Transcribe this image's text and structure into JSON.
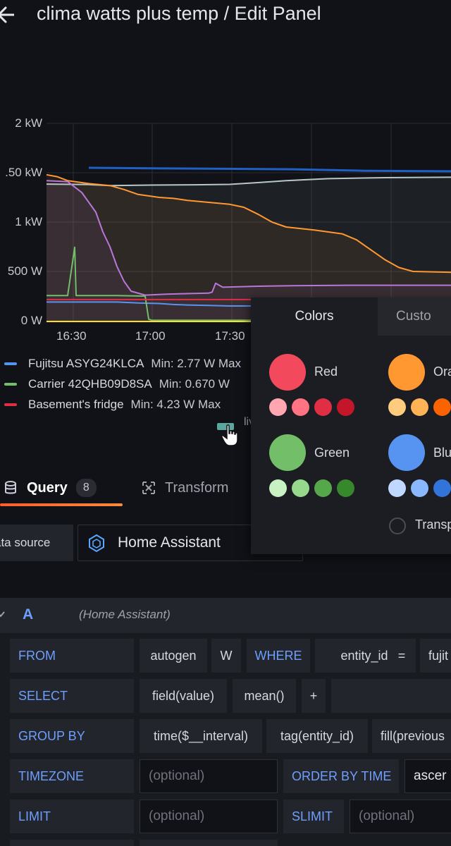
{
  "header": {
    "title": "clima watts plus temp / Edit Panel",
    "back_icon": "arrow-left-icon"
  },
  "chart_data": {
    "type": "line",
    "yticks": [
      "2 kW",
      ".50 kW",
      "1 kW",
      "500 W",
      "0 W"
    ],
    "xticks": [
      "16:30",
      "17:00",
      "17:30"
    ],
    "ylim": [
      0,
      2000
    ],
    "grid": true,
    "series": [
      {
        "name": "Fujitsu ASYG24KLCA",
        "color": "#5794F2",
        "values": [
          [
            0,
            190
          ],
          [
            60,
            190
          ],
          [
            100,
            190
          ],
          [
            130,
            180
          ],
          [
            160,
            175
          ],
          [
            180,
            165
          ],
          [
            200,
            160
          ],
          [
            230,
            155
          ],
          [
            260,
            150
          ],
          [
            300,
            150
          ],
          [
            330,
            148
          ],
          [
            360,
            150
          ],
          [
            420,
            150
          ],
          [
            500,
            150
          ],
          [
            580,
            150
          ]
        ]
      },
      {
        "name": "Carrier 42QHB09D8SA",
        "color": "#73BF69",
        "values": [
          [
            0,
            255
          ],
          [
            30,
            255
          ],
          [
            40,
            745
          ],
          [
            42,
            255
          ],
          [
            100,
            255
          ],
          [
            140,
            250
          ],
          [
            145,
            15
          ],
          [
            150,
            5
          ],
          [
            580,
            5
          ]
        ]
      },
      {
        "name": "Basement's fridge",
        "color": "#E02F44",
        "values": [
          [
            0,
            215
          ],
          [
            580,
            215
          ]
        ]
      },
      {
        "name": "",
        "color": "#1F60C4",
        "values": [
          [
            60,
            1550
          ],
          [
            150,
            1545
          ],
          [
            250,
            1540
          ],
          [
            350,
            1535
          ],
          [
            450,
            1520
          ],
          [
            580,
            1515
          ]
        ]
      },
      {
        "name": "",
        "color": "#B8C7C5",
        "values": [
          [
            0,
            1385
          ],
          [
            60,
            1380
          ],
          [
            90,
            1370
          ],
          [
            150,
            1375
          ],
          [
            210,
            1378
          ],
          [
            260,
            1382
          ],
          [
            300,
            1400
          ],
          [
            340,
            1420
          ],
          [
            400,
            1440
          ],
          [
            480,
            1450
          ],
          [
            580,
            1455
          ]
        ]
      },
      {
        "name": "",
        "color": "#FF9830",
        "values": [
          [
            0,
            1480
          ],
          [
            15,
            1460
          ],
          [
            30,
            1420
          ],
          [
            60,
            1390
          ],
          [
            90,
            1370
          ],
          [
            110,
            1330
          ],
          [
            130,
            1280
          ],
          [
            160,
            1250
          ],
          [
            180,
            1240
          ],
          [
            200,
            1220
          ],
          [
            230,
            1200
          ],
          [
            260,
            1180
          ],
          [
            280,
            1150
          ],
          [
            300,
            1080
          ],
          [
            320,
            1000
          ],
          [
            340,
            950
          ],
          [
            380,
            920
          ],
          [
            420,
            880
          ],
          [
            440,
            820
          ],
          [
            460,
            720
          ],
          [
            480,
            620
          ],
          [
            500,
            540
          ],
          [
            520,
            500
          ],
          [
            580,
            490
          ]
        ]
      },
      {
        "name": "",
        "color": "#B877D9",
        "values": [
          [
            0,
            1420
          ],
          [
            30,
            1410
          ],
          [
            50,
            1300
          ],
          [
            70,
            1100
          ],
          [
            80,
            900
          ],
          [
            90,
            750
          ],
          [
            100,
            550
          ],
          [
            110,
            400
          ],
          [
            120,
            300
          ],
          [
            140,
            260
          ],
          [
            170,
            270
          ],
          [
            230,
            280
          ],
          [
            235,
            290
          ],
          [
            240,
            380
          ],
          [
            250,
            340
          ],
          [
            300,
            350
          ],
          [
            350,
            355
          ],
          [
            430,
            360
          ],
          [
            500,
            360
          ],
          [
            580,
            360
          ]
        ]
      }
    ]
  },
  "legend": {
    "items": [
      {
        "name": "Fujitsu ASYG24KLCA",
        "stat": "Min: 2.77 W  Max",
        "color": "#5794F2"
      },
      {
        "name": "Carrier 42QHB09D8SA",
        "stat": "Min: 0.670 W",
        "color": "#73BF69"
      },
      {
        "name": "Basement's fridge",
        "stat": "Min: 4.23 W  Max",
        "color": "#E02F44"
      }
    ]
  },
  "cursor_text": "liv",
  "tabs": {
    "query_label": "Query",
    "query_count": "8",
    "transform_label": "Transform"
  },
  "datasource": {
    "label": "Data source",
    "label_visible": "ata source",
    "value": "Home Assistant"
  },
  "query": {
    "ref": "A",
    "ds": "(Home Assistant)",
    "from": {
      "label": "FROM",
      "policy": "autogen",
      "measurement": "W",
      "where": "WHERE",
      "key": "entity_id",
      "op": "=",
      "value": "fujit"
    },
    "select": {
      "label": "SELECT",
      "field": "field(value)",
      "agg": "mean()",
      "add": "+"
    },
    "group_by": {
      "label": "GROUP BY",
      "time": "time($__interval)",
      "tag": "tag(entity_id)",
      "fill": "fill(previous"
    },
    "timezone": {
      "label": "TIMEZONE",
      "placeholder": "(optional)",
      "order_label": "ORDER BY TIME",
      "order_value": "ascer"
    },
    "limit": {
      "label": "LIMIT",
      "placeholder": "(optional)",
      "slimit_label": "SLIMIT",
      "slimit_placeholder": "(optional)"
    }
  },
  "color_picker": {
    "tab_colors": "Colors",
    "tab_custom": "Custom",
    "tab_custom_visible": "Custo",
    "groups": [
      {
        "name": "Red",
        "main": "#F2495C",
        "shades": [
          "#FFA6B0",
          "#FF7383",
          "#E02F44",
          "#C4162A"
        ]
      },
      {
        "name": "Ora",
        "main": "#FF9830",
        "shades": [
          "#FFCB7D",
          "#FFB357",
          "#FA6400",
          "#FA6400"
        ]
      },
      {
        "name": "Green",
        "main": "#73BF69",
        "shades": [
          "#C8F2C2",
          "#96D98D",
          "#56A64B",
          "#37872D"
        ]
      },
      {
        "name": "Blu",
        "main": "#5794F2",
        "shades": [
          "#C0D8FF",
          "#8AB8FF",
          "#3274D9",
          "#1F60C4"
        ]
      }
    ],
    "transparent_label": "Transp"
  }
}
